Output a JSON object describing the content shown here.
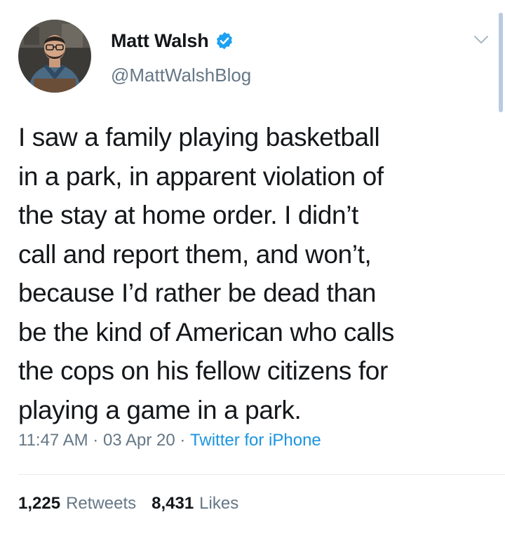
{
  "author": {
    "display_name": "Matt Walsh",
    "handle": "@MattWalshBlog",
    "verified": true,
    "avatar_icon": "profile-photo"
  },
  "tweet": {
    "text": "I saw a family playing basketball\nin a park, in apparent violation of\nthe stay at home order. I didn’t\ncall and report them, and won’t,\nbecause I’d rather be dead than\nbe the kind of American who calls\nthe cops on his fellow citizens for\nplaying a game in a park.",
    "time": "11:47 AM",
    "separator": " · ",
    "date": "03 Apr 20",
    "source": "Twitter for iPhone"
  },
  "stats": {
    "retweets_count": "1,225",
    "retweets_label": "Retweets",
    "likes_count": "8,431",
    "likes_label": "Likes"
  },
  "icons": {
    "verified": "verified-badge-icon",
    "menu": "chevron-down-icon"
  },
  "colors": {
    "text": "#14171a",
    "secondary": "#657786",
    "link": "#1b95e0",
    "verified": "#1da1f2",
    "divider": "#e6ecf0"
  }
}
